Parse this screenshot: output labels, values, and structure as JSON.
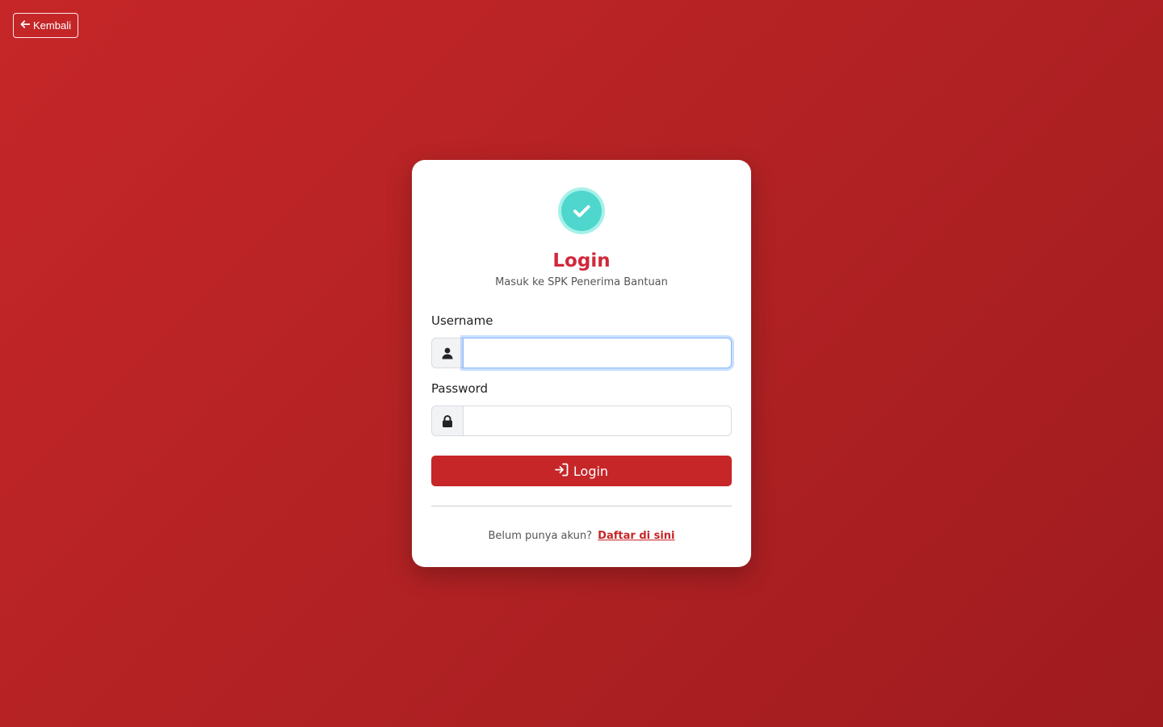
{
  "nav": {
    "back_label": "Kembali"
  },
  "card": {
    "title": "Login",
    "subtitle": "Masuk ke SPK Penerima Bantuan"
  },
  "form": {
    "username_label": "Username",
    "username_value": "",
    "password_label": "Password",
    "password_value": "",
    "submit_label": "Login"
  },
  "footer": {
    "prompt": "Belum punya akun?",
    "register_link": "Daftar di sini"
  },
  "icons": {
    "back": "arrow-left-icon",
    "logo": "check-circle-icon",
    "username": "user-icon",
    "password": "lock-icon",
    "submit": "sign-in-icon"
  },
  "colors": {
    "background": "#c62628",
    "accent": "#d0283a",
    "logo": "#4fd6cd"
  }
}
